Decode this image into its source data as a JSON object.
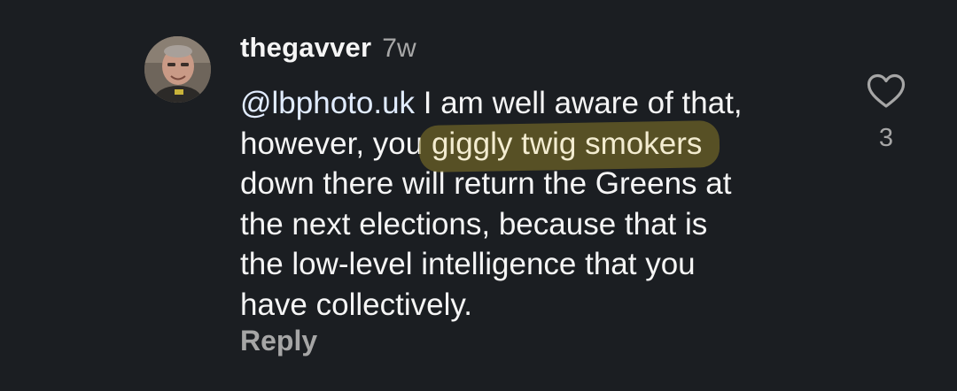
{
  "comment": {
    "username": "thegavver",
    "time": "7w",
    "mention": "@lbphoto.uk",
    "lines": {
      "l1_rest": " I am well aware of that,",
      "l2_before": "however, you ",
      "l2_highlight": "giggly twig smokers",
      "l3": "down there will return the Greens at",
      "l4": "the next elections, because that is",
      "l5": "the low-level intelligence that you",
      "l6": "have collectively."
    },
    "reply_label": "Reply",
    "like_count": "3",
    "highlight_color": "#7c7026"
  },
  "icons": {
    "like": "heart-outline-icon",
    "avatar": "user-avatar-photo"
  }
}
